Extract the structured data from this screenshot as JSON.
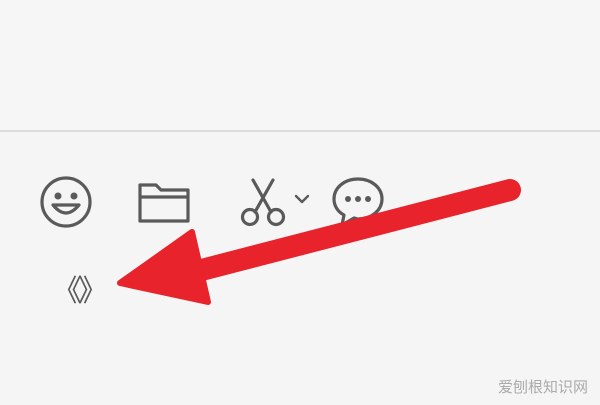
{
  "toolbar": {
    "items": [
      {
        "name": "emoji",
        "icon": "smiley-face-icon"
      },
      {
        "name": "file",
        "icon": "folder-icon"
      },
      {
        "name": "screenshot",
        "icon": "scissors-icon",
        "has_dropdown": true
      },
      {
        "name": "chat-history",
        "icon": "speech-bubble-icon"
      }
    ],
    "code_symbol": "《》"
  },
  "annotation": {
    "arrow_color": "#e8232b"
  },
  "colors": {
    "background": "#f5f5f5",
    "icon": "#5a5a5a",
    "divider": "#dcdcdc"
  },
  "watermark": {
    "text": "爱刨根知识网"
  }
}
